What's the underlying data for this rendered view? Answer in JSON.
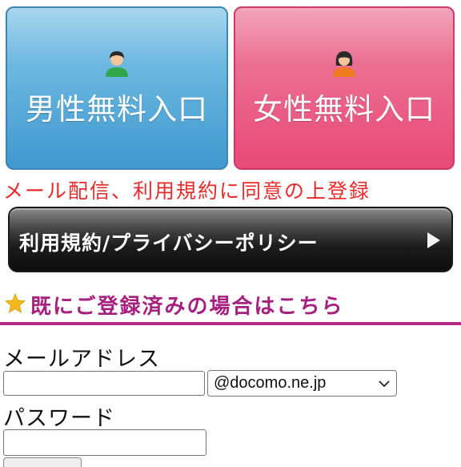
{
  "entry_buttons": {
    "male": {
      "label": "男性無料入口",
      "icon": "male-person-icon",
      "color": "#3f98cf"
    },
    "female": {
      "label": "女性無料入口",
      "icon": "female-person-icon",
      "color": "#e84a77"
    }
  },
  "notice": {
    "text": "メール配信、利用規約に同意の上登録",
    "color": "#ea2a2a"
  },
  "policy_button": {
    "label": "利用規約/プライバシーポリシー",
    "icon": "play-arrow-icon"
  },
  "login_section": {
    "icon": "star-icon",
    "title": "既にご登録済みの場合はこちら",
    "accent_color": "#a6207f"
  },
  "form": {
    "email_label": "メールアドレス",
    "email_value": "",
    "domain_selected": "@docomo.ne.jp",
    "password_label": "パスワード",
    "password_value": ""
  }
}
